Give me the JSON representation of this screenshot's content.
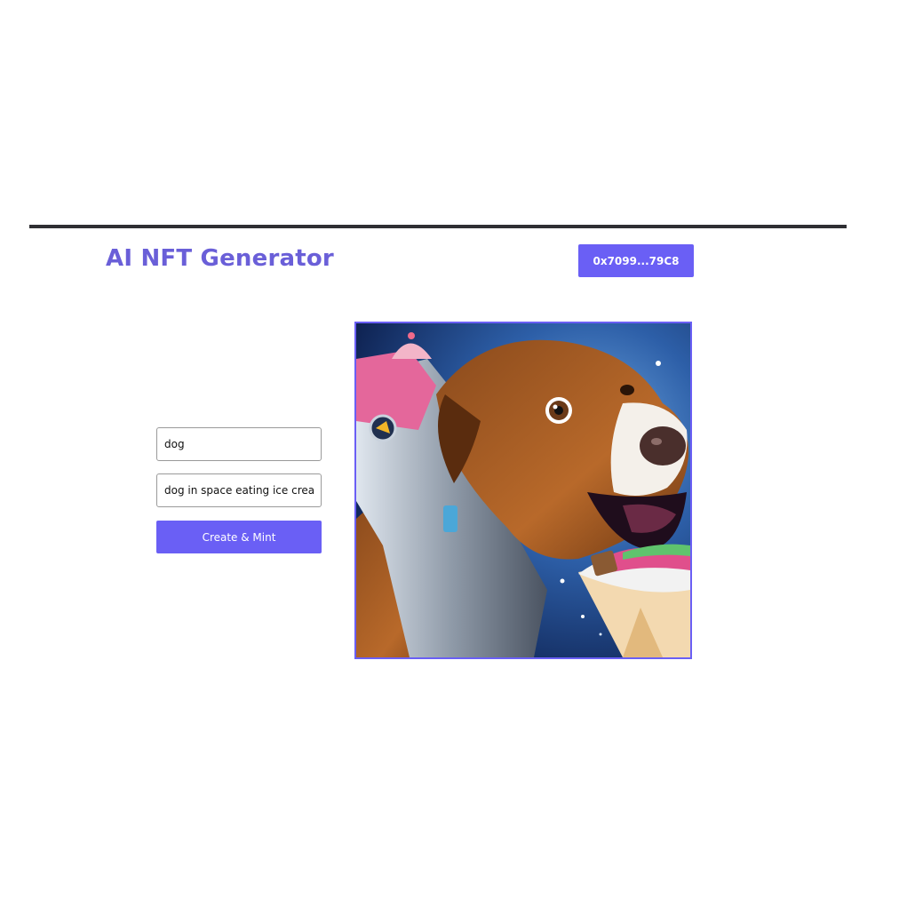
{
  "header": {
    "title": "AI NFT Generator",
    "wallet_address": "0x7099...79C8"
  },
  "form": {
    "name_input": {
      "value": "dog"
    },
    "description_input": {
      "value": "dog in space eating ice cream"
    },
    "submit_label": "Create & Mint"
  },
  "preview": {
    "image_subject": "dog in space eating ice cream"
  },
  "colors": {
    "accent": "#6a5ff5",
    "title": "#6a5fd8",
    "rule": "#2f2f33"
  }
}
